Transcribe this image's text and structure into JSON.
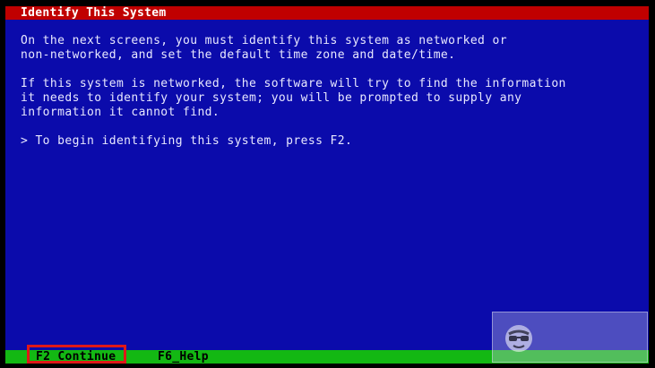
{
  "window": {
    "title": "Identify This System"
  },
  "body": {
    "paragraph1": [
      "On the next screens, you must identify this system as networked or",
      "non-networked, and set the default time zone and date/time."
    ],
    "paragraph2": [
      "If this system is networked, the software will try to find the information",
      "it needs to identify your system; you will be prompted to supply any",
      "information it cannot find."
    ],
    "instruction": "> To begin identifying this system, press F2."
  },
  "footer": {
    "keys": [
      {
        "label": "F2_Continue"
      },
      {
        "label": "F6_Help"
      }
    ]
  },
  "colors": {
    "title_bar": "#c00000",
    "content_bg": "#0b0bab",
    "footer_bar": "#13b813",
    "highlight_box": "#e01818"
  },
  "watermark": {
    "icon": "sunglasses-face-icon"
  }
}
